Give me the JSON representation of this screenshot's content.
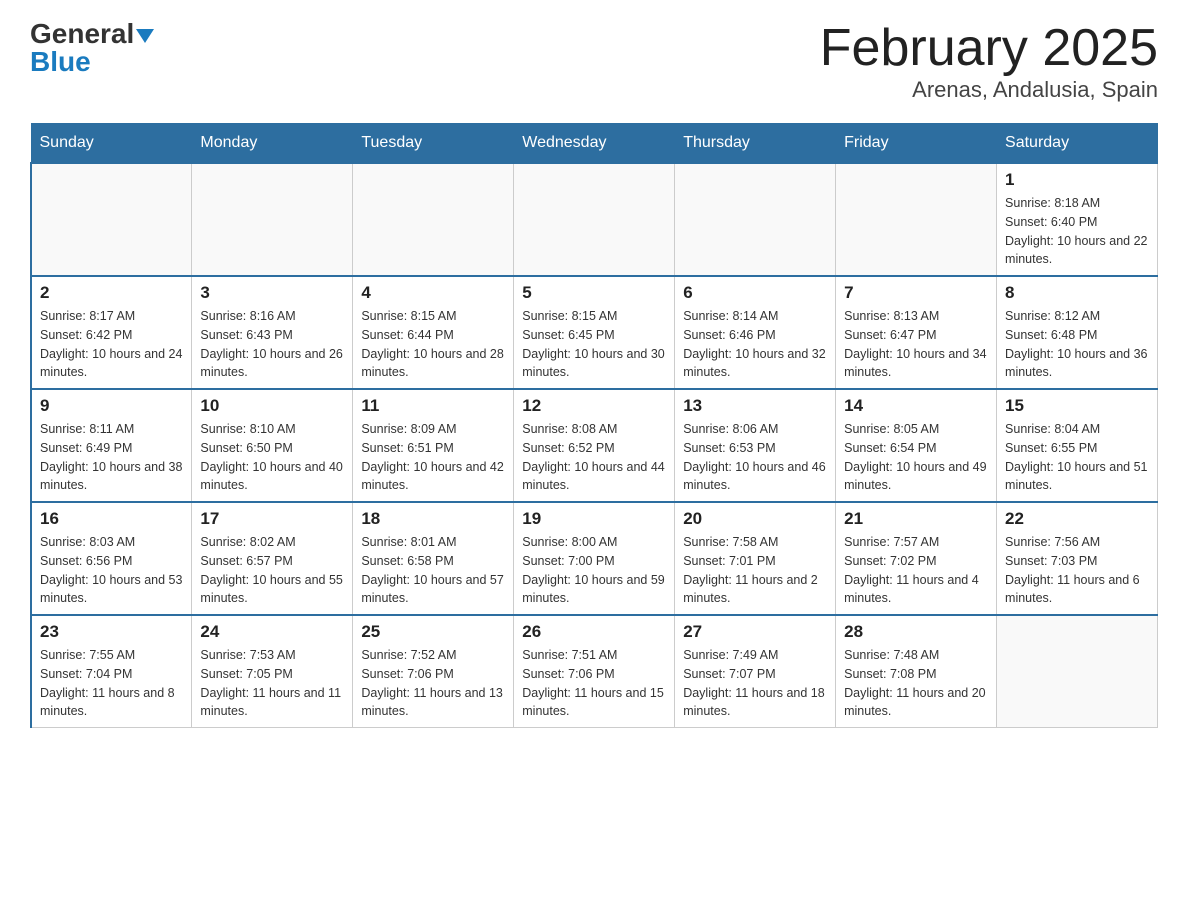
{
  "header": {
    "logo_general": "General",
    "logo_blue": "Blue",
    "title": "February 2025",
    "subtitle": "Arenas, Andalusia, Spain"
  },
  "days_of_week": [
    "Sunday",
    "Monday",
    "Tuesday",
    "Wednesday",
    "Thursday",
    "Friday",
    "Saturday"
  ],
  "weeks": [
    [
      {
        "day": "",
        "info": ""
      },
      {
        "day": "",
        "info": ""
      },
      {
        "day": "",
        "info": ""
      },
      {
        "day": "",
        "info": ""
      },
      {
        "day": "",
        "info": ""
      },
      {
        "day": "",
        "info": ""
      },
      {
        "day": "1",
        "info": "Sunrise: 8:18 AM\nSunset: 6:40 PM\nDaylight: 10 hours and 22 minutes."
      }
    ],
    [
      {
        "day": "2",
        "info": "Sunrise: 8:17 AM\nSunset: 6:42 PM\nDaylight: 10 hours and 24 minutes."
      },
      {
        "day": "3",
        "info": "Sunrise: 8:16 AM\nSunset: 6:43 PM\nDaylight: 10 hours and 26 minutes."
      },
      {
        "day": "4",
        "info": "Sunrise: 8:15 AM\nSunset: 6:44 PM\nDaylight: 10 hours and 28 minutes."
      },
      {
        "day": "5",
        "info": "Sunrise: 8:15 AM\nSunset: 6:45 PM\nDaylight: 10 hours and 30 minutes."
      },
      {
        "day": "6",
        "info": "Sunrise: 8:14 AM\nSunset: 6:46 PM\nDaylight: 10 hours and 32 minutes."
      },
      {
        "day": "7",
        "info": "Sunrise: 8:13 AM\nSunset: 6:47 PM\nDaylight: 10 hours and 34 minutes."
      },
      {
        "day": "8",
        "info": "Sunrise: 8:12 AM\nSunset: 6:48 PM\nDaylight: 10 hours and 36 minutes."
      }
    ],
    [
      {
        "day": "9",
        "info": "Sunrise: 8:11 AM\nSunset: 6:49 PM\nDaylight: 10 hours and 38 minutes."
      },
      {
        "day": "10",
        "info": "Sunrise: 8:10 AM\nSunset: 6:50 PM\nDaylight: 10 hours and 40 minutes."
      },
      {
        "day": "11",
        "info": "Sunrise: 8:09 AM\nSunset: 6:51 PM\nDaylight: 10 hours and 42 minutes."
      },
      {
        "day": "12",
        "info": "Sunrise: 8:08 AM\nSunset: 6:52 PM\nDaylight: 10 hours and 44 minutes."
      },
      {
        "day": "13",
        "info": "Sunrise: 8:06 AM\nSunset: 6:53 PM\nDaylight: 10 hours and 46 minutes."
      },
      {
        "day": "14",
        "info": "Sunrise: 8:05 AM\nSunset: 6:54 PM\nDaylight: 10 hours and 49 minutes."
      },
      {
        "day": "15",
        "info": "Sunrise: 8:04 AM\nSunset: 6:55 PM\nDaylight: 10 hours and 51 minutes."
      }
    ],
    [
      {
        "day": "16",
        "info": "Sunrise: 8:03 AM\nSunset: 6:56 PM\nDaylight: 10 hours and 53 minutes."
      },
      {
        "day": "17",
        "info": "Sunrise: 8:02 AM\nSunset: 6:57 PM\nDaylight: 10 hours and 55 minutes."
      },
      {
        "day": "18",
        "info": "Sunrise: 8:01 AM\nSunset: 6:58 PM\nDaylight: 10 hours and 57 minutes."
      },
      {
        "day": "19",
        "info": "Sunrise: 8:00 AM\nSunset: 7:00 PM\nDaylight: 10 hours and 59 minutes."
      },
      {
        "day": "20",
        "info": "Sunrise: 7:58 AM\nSunset: 7:01 PM\nDaylight: 11 hours and 2 minutes."
      },
      {
        "day": "21",
        "info": "Sunrise: 7:57 AM\nSunset: 7:02 PM\nDaylight: 11 hours and 4 minutes."
      },
      {
        "day": "22",
        "info": "Sunrise: 7:56 AM\nSunset: 7:03 PM\nDaylight: 11 hours and 6 minutes."
      }
    ],
    [
      {
        "day": "23",
        "info": "Sunrise: 7:55 AM\nSunset: 7:04 PM\nDaylight: 11 hours and 8 minutes."
      },
      {
        "day": "24",
        "info": "Sunrise: 7:53 AM\nSunset: 7:05 PM\nDaylight: 11 hours and 11 minutes."
      },
      {
        "day": "25",
        "info": "Sunrise: 7:52 AM\nSunset: 7:06 PM\nDaylight: 11 hours and 13 minutes."
      },
      {
        "day": "26",
        "info": "Sunrise: 7:51 AM\nSunset: 7:06 PM\nDaylight: 11 hours and 15 minutes."
      },
      {
        "day": "27",
        "info": "Sunrise: 7:49 AM\nSunset: 7:07 PM\nDaylight: 11 hours and 18 minutes."
      },
      {
        "day": "28",
        "info": "Sunrise: 7:48 AM\nSunset: 7:08 PM\nDaylight: 11 hours and 20 minutes."
      },
      {
        "day": "",
        "info": ""
      }
    ]
  ]
}
